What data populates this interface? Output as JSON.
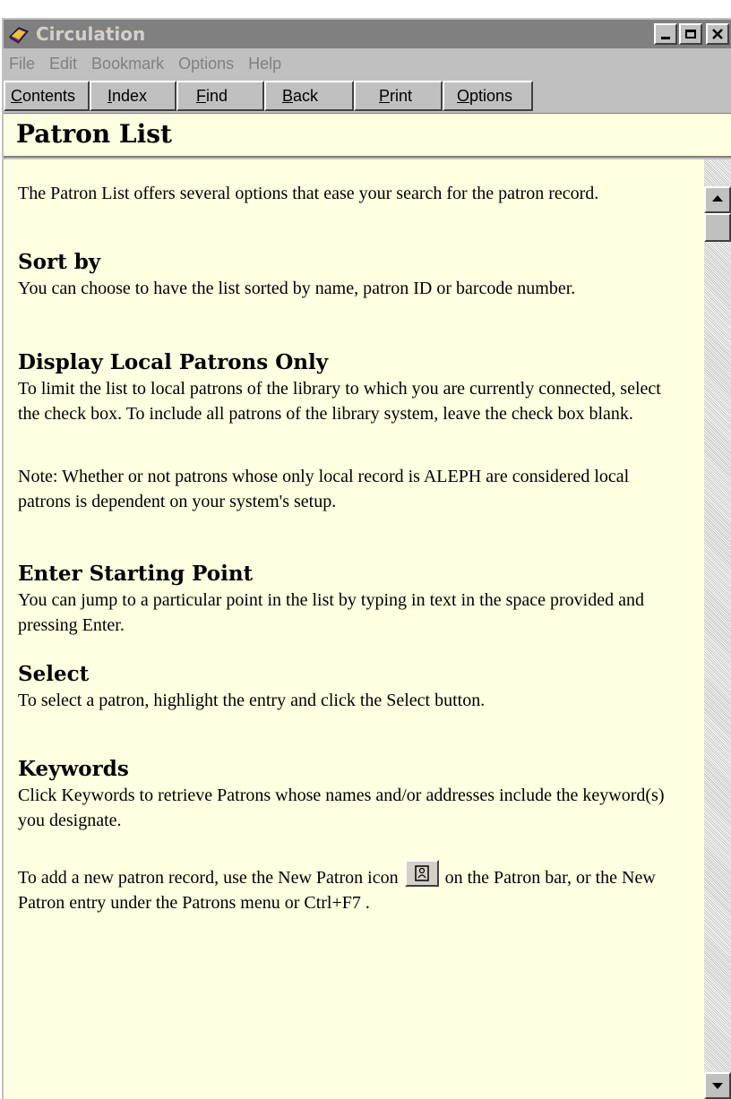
{
  "window": {
    "title": "Circulation"
  },
  "menu": {
    "items": [
      "File",
      "Edit",
      "Bookmark",
      "Options",
      "Help"
    ]
  },
  "toolbar": {
    "buttons": [
      {
        "label": "Contents",
        "underline": "C",
        "rest": "ontents"
      },
      {
        "label": "Index",
        "underline": "I",
        "rest": "ndex"
      },
      {
        "label": "Find",
        "underline": "F",
        "rest": "ind"
      },
      {
        "label": "Back",
        "underline": "B",
        "rest": "ack"
      },
      {
        "label": "Print",
        "underline": "P",
        "rest": "rint"
      },
      {
        "label": "Options",
        "underline": "O",
        "rest": "ptions"
      }
    ]
  },
  "topic": {
    "title": "Patron List",
    "intro": "The Patron List offers several options that ease your search for the patron record.",
    "sections": [
      {
        "heading": "Sort by",
        "body": "You can choose to have the list sorted by name, patron ID or barcode number."
      },
      {
        "heading": "Display Local Patrons Only",
        "body": "To limit the list to local patrons of the library to which you are currently connected, select the check box. To include all patrons of the library system, leave the check box blank.",
        "note": "Note: Whether or not patrons whose only local record is ALEPH are considered local patrons is dependent on your system's setup."
      },
      {
        "heading": "Enter Starting Point",
        "body": "You can jump to a particular point in the list by typing in text in the space provided and pressing Enter."
      },
      {
        "heading": "Select",
        "body": "To select a patron, highlight the entry and click the Select button."
      },
      {
        "heading": "Keywords",
        "body": "Click Keywords to retrieve Patrons whose names and/or addresses include the keyword(s) you designate."
      }
    ],
    "footer_before_icon": "To add a new patron record, use the New Patron icon",
    "footer_after_icon": "on the Patron bar, or the New Patron entry under the Patrons menu or Ctrl+F7 .",
    "footer_icon": "new-patron-icon"
  },
  "colors": {
    "content_bg": "#ffffe1",
    "title_bar": "#808080",
    "chrome": "#c0c0c0"
  }
}
